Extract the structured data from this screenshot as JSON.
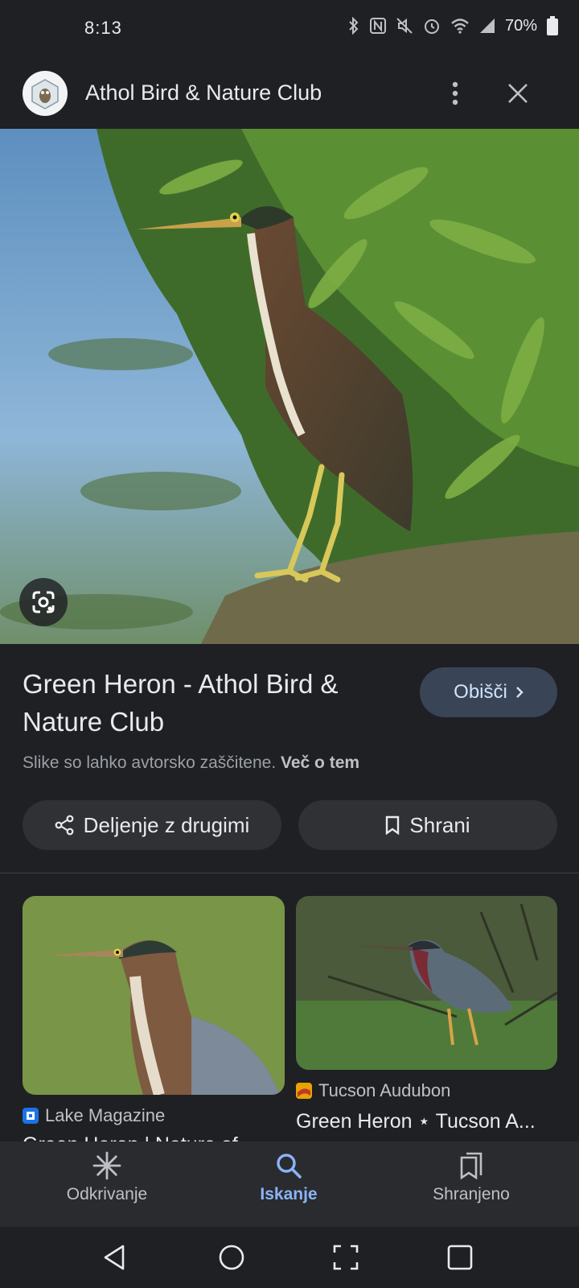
{
  "status_bar": {
    "time": "8:13",
    "battery": "70%"
  },
  "header": {
    "site_name": "Athol Bird & Nature Club",
    "logo_icon": "owl-logo-icon",
    "menu_icon": "more-vert-icon",
    "close_icon": "close-icon"
  },
  "hero": {
    "image": "green-heron-photo",
    "lens_icon": "google-lens-icon"
  },
  "result": {
    "title": "Green Heron - Athol Bird & Nature Club",
    "visit_label": "Obišči",
    "copyright_text": "Slike so lahko avtorsko zaščitene.",
    "learn_more": "Več o tem",
    "share_label": "Deljenje z drugimi",
    "save_label": "Shrani"
  },
  "related": [
    {
      "source": "Lake Magazine",
      "title": "Green Heron | Nature of",
      "favicon_color": "#1a73e8"
    },
    {
      "source": "Tucson Audubon",
      "title": "Green Heron ⋆ Tucson A...",
      "favicon_color": "#e8a400"
    }
  ],
  "bottom_nav": [
    {
      "label": "Odkrivanje",
      "icon": "discover-asterisk-icon"
    },
    {
      "label": "Iskanje",
      "icon": "search-icon"
    },
    {
      "label": "Shranjeno",
      "icon": "saved-collections-icon"
    }
  ],
  "colors": {
    "background": "#1f2023",
    "accent": "#8ab4f8",
    "visit_button": "#394457"
  }
}
